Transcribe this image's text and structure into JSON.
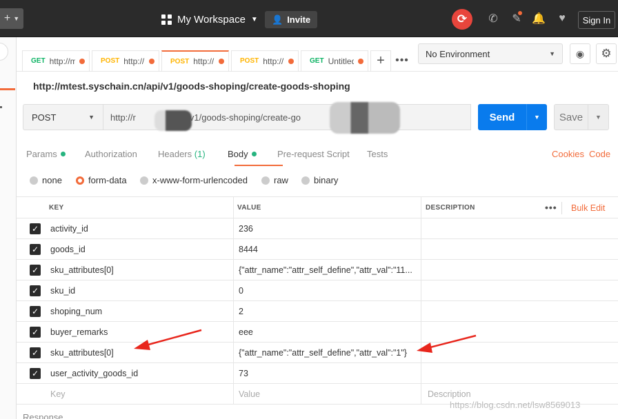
{
  "topbar": {
    "new_icon": "+",
    "workspace_label": "My Workspace",
    "invite_label": "Invite",
    "signin_label": "Sign In",
    "icons": [
      "grid-icon",
      "user-plus-icon",
      "sync-icon",
      "satellite-icon",
      "wrench-icon",
      "bell-icon",
      "heart-icon"
    ]
  },
  "tabs": [
    {
      "method": "GET",
      "url": "http://m"
    },
    {
      "method": "POST",
      "url": "http://r"
    },
    {
      "method": "POST",
      "url": "http://r"
    },
    {
      "method": "POST",
      "url": "http://r"
    },
    {
      "method": "GET",
      "url": "Untitled"
    }
  ],
  "tab_add": "+",
  "tab_more": "•••",
  "environment": {
    "selected": "No Environment"
  },
  "request": {
    "title": "http://mtest.syschain.cn/api/v1/goods-shoping/create-goods-shoping",
    "method": "POST",
    "url": "http://r          .cn/api/v1/goods-shoping/create-go",
    "send_label": "Send",
    "save_label": "Save"
  },
  "subtabs": {
    "params": "Params",
    "authorization": "Authorization",
    "headers": "Headers",
    "headers_count": "(1)",
    "body": "Body",
    "prerequest": "Pre-request Script",
    "tests": "Tests",
    "cookies": "Cookies",
    "code": "Code"
  },
  "body_modes": {
    "none": "none",
    "form_data": "form-data",
    "urlencoded": "x-www-form-urlencoded",
    "raw": "raw",
    "binary": "binary",
    "selected": "form-data"
  },
  "table": {
    "headers": {
      "key": "KEY",
      "value": "VALUE",
      "description": "DESCRIPTION"
    },
    "head_more": "•••",
    "bulk_edit": "Bulk Edit",
    "rows": [
      {
        "key": "activity_id",
        "value": "236"
      },
      {
        "key": "goods_id",
        "value": "8444"
      },
      {
        "key": "sku_attributes[0]",
        "value": "{\"attr_name\":\"attr_self_define\",\"attr_val\":\"11..."
      },
      {
        "key": "sku_id",
        "value": "0"
      },
      {
        "key": "shoping_num",
        "value": "2"
      },
      {
        "key": "buyer_remarks",
        "value": "eee"
      },
      {
        "key": "sku_attributes[0]",
        "value": "{\"attr_name\":\"attr_self_define\",\"attr_val\":\"1\"}"
      },
      {
        "key": "user_activity_goods_id",
        "value": "73"
      }
    ],
    "placeholders": {
      "key": "Key",
      "value": "Value",
      "description": "Description"
    }
  },
  "response_label": "Response",
  "watermark": "https://blog.csdn.net/lsw8569013",
  "colors": {
    "accent": "#f26b3a",
    "send": "#097bed",
    "success": "#26b47f",
    "get": "#0cb363",
    "post": "#ffb400",
    "arrow": "#e8261c"
  }
}
